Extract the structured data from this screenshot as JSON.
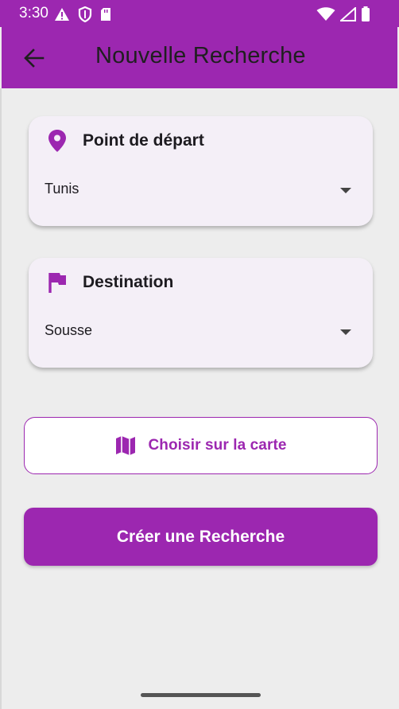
{
  "status_bar": {
    "time": "3:30",
    "icons_left": [
      "warning-icon",
      "shield-icon",
      "sd-card-icon"
    ],
    "icons_right": [
      "wifi-icon",
      "signal-icon",
      "battery-icon"
    ]
  },
  "app_bar": {
    "back_icon": "arrow-back-icon",
    "title": "Nouvelle Recherche"
  },
  "departure_card": {
    "icon": "location-pin-icon",
    "title": "Point de départ",
    "selected_value": "Tunis"
  },
  "destination_card": {
    "icon": "flag-icon",
    "title": "Destination",
    "selected_value": "Sousse"
  },
  "map_button": {
    "icon": "map-icon",
    "label": "Choisir sur la carte"
  },
  "create_button": {
    "label": "Créer une Recherche"
  },
  "colors": {
    "primary": "#9c27b0",
    "card_background": "#f4eff7",
    "page_background": "#ededed"
  }
}
